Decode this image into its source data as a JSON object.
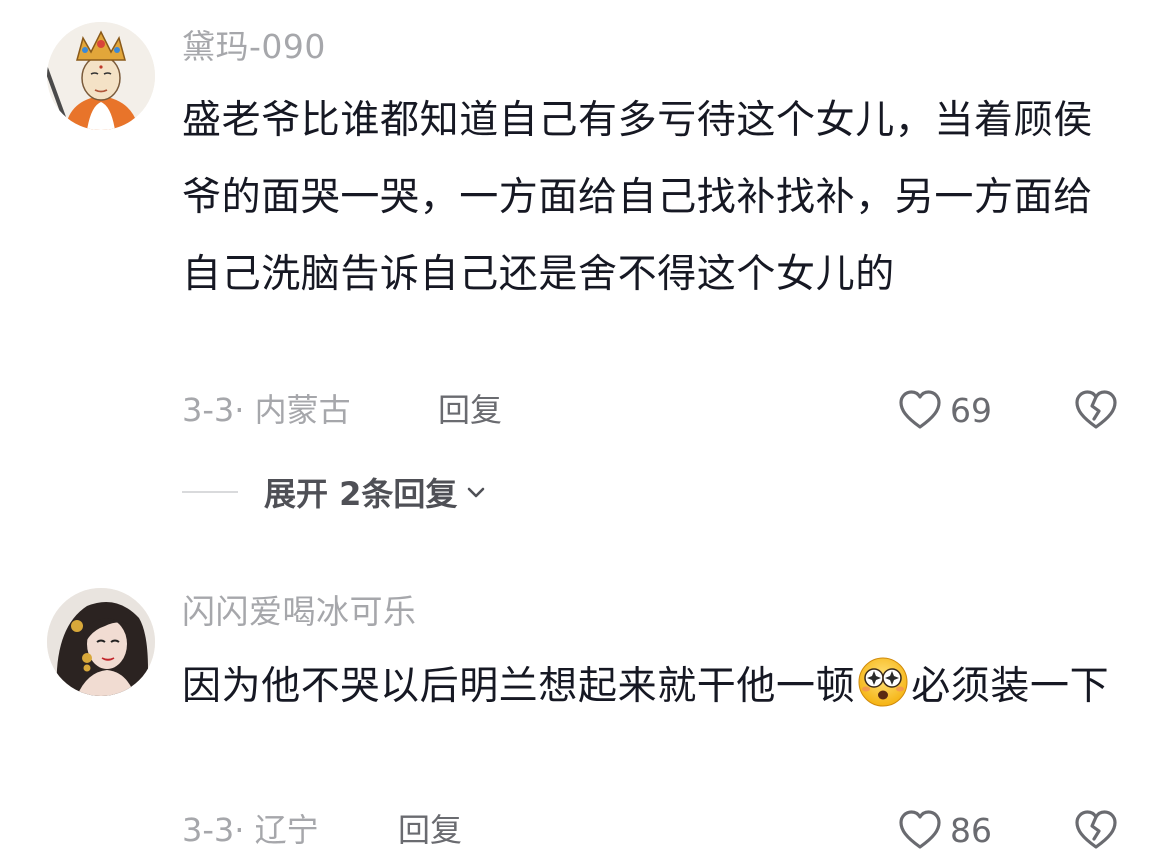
{
  "comments": [
    {
      "username": "黛玛-090",
      "text": "盛老爷比谁都知道自己有多亏待这个女儿，当着顾侯爷的面哭一哭，一方面给自己找补找补，另一方面给自己洗脑告诉自己还是舍不得这个女儿的",
      "date_location": "3-3· 内蒙古",
      "reply_label": "回复",
      "likes": "69",
      "avatar_icon": "bodhisattva-avatar",
      "expand_label": "展开 2条回复"
    },
    {
      "username": "闪闪爱喝冰可乐",
      "text_before_emoji": "因为他不哭以后明兰想起来就干他一顿",
      "emoji": "starry-eyed-emoji",
      "text_after_emoji": "必须装一下",
      "date_location": "3-3· 辽宁",
      "reply_label": "回复",
      "likes": "86",
      "avatar_icon": "woman-portrait-avatar"
    }
  ],
  "colors": {
    "text_primary": "#161823",
    "text_secondary": "#a6a7ab",
    "action": "#6a6b70"
  }
}
